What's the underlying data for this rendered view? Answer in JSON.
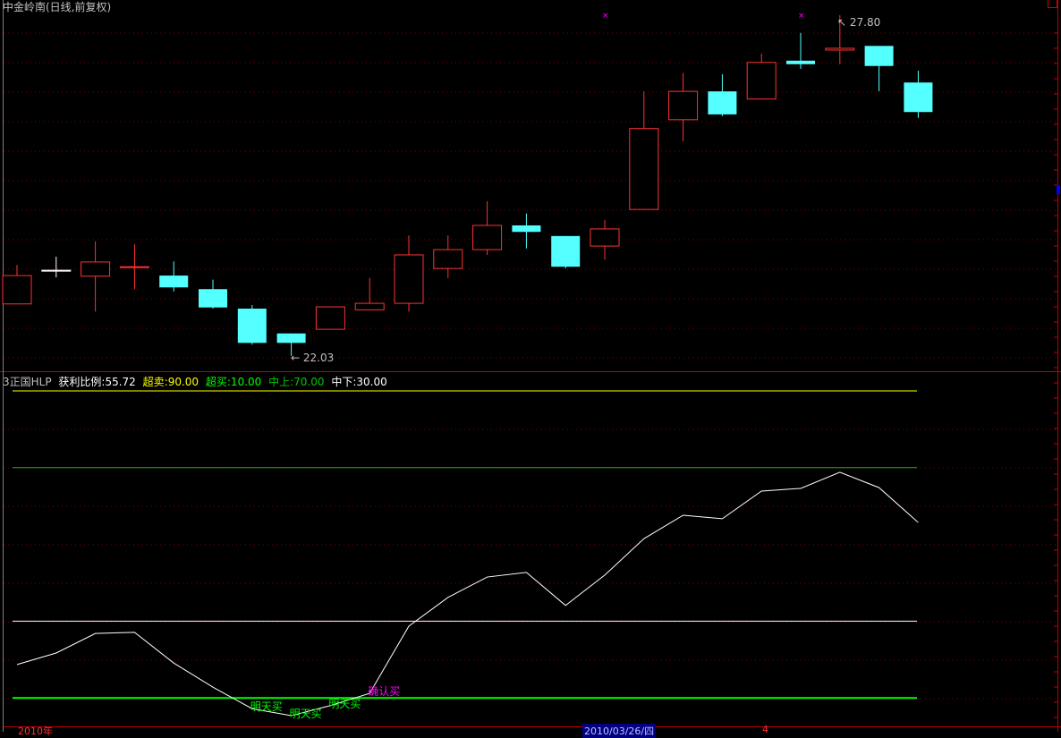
{
  "header": {
    "title": "中金岭南(日线,前复权)"
  },
  "price_panel": {
    "high_label": "27.80",
    "low_label": "22.03",
    "candles": [
      {
        "o": 22.91,
        "h": 23.57,
        "l": 22.91,
        "c": 23.39
      },
      {
        "o": 23.48,
        "h": 23.71,
        "l": 23.36,
        "c": 23.48
      },
      {
        "o": 23.38,
        "h": 23.97,
        "l": 22.78,
        "c": 23.62
      },
      {
        "o": 23.54,
        "h": 23.92,
        "l": 23.16,
        "c": 23.54
      },
      {
        "o": 23.39,
        "h": 23.63,
        "l": 23.12,
        "c": 23.19
      },
      {
        "o": 23.16,
        "h": 23.32,
        "l": 22.83,
        "c": 22.85
      },
      {
        "o": 22.83,
        "h": 22.89,
        "l": 22.22,
        "c": 22.25
      },
      {
        "o": 22.41,
        "h": 22.41,
        "l": 22.03,
        "c": 22.25
      },
      {
        "o": 22.48,
        "h": 22.86,
        "l": 22.48,
        "c": 22.86
      },
      {
        "o": 22.81,
        "h": 23.35,
        "l": 22.81,
        "c": 22.92
      },
      {
        "o": 22.92,
        "h": 24.07,
        "l": 22.78,
        "c": 23.74
      },
      {
        "o": 23.51,
        "h": 24.07,
        "l": 23.35,
        "c": 23.83
      },
      {
        "o": 23.83,
        "h": 24.65,
        "l": 23.74,
        "c": 24.24
      },
      {
        "o": 24.24,
        "h": 24.44,
        "l": 23.85,
        "c": 24.13
      },
      {
        "o": 24.06,
        "h": 24.06,
        "l": 23.51,
        "c": 23.54
      },
      {
        "o": 23.89,
        "h": 24.33,
        "l": 23.66,
        "c": 24.18
      },
      {
        "o": 24.51,
        "h": 26.51,
        "l": 24.51,
        "c": 25.88
      },
      {
        "o": 26.03,
        "h": 26.82,
        "l": 25.66,
        "c": 26.51
      },
      {
        "o": 26.51,
        "h": 26.8,
        "l": 26.09,
        "c": 26.12
      },
      {
        "o": 26.38,
        "h": 27.15,
        "l": 26.38,
        "c": 27.0
      },
      {
        "o": 27.03,
        "h": 27.5,
        "l": 26.89,
        "c": 26.97
      },
      {
        "o": 27.21,
        "h": 27.8,
        "l": 26.97,
        "c": 27.24
      },
      {
        "o": 27.28,
        "h": 27.28,
        "l": 26.51,
        "c": 26.94
      },
      {
        "o": 26.66,
        "h": 26.86,
        "l": 26.06,
        "c": 26.16
      }
    ],
    "markers": [
      15,
      20
    ],
    "colors": {
      "up": "#ff3232",
      "down": "#54ffff",
      "marker": "#ff00ff",
      "grid": "#800000",
      "border": "#c00000"
    }
  },
  "indicator": {
    "name": "3正国HLP",
    "profit_label": "获利比例:55.72",
    "overbought_label": "超卖:90.00",
    "oversold_label": "超买:10.00",
    "mid_upper_label": "中上:70.00",
    "mid_lower_label": "中下:30.00",
    "levels": [
      {
        "v": 90,
        "color": "#ffff00"
      },
      {
        "v": 70,
        "color": "#00c800"
      },
      {
        "v": 30,
        "color": "#ffffff"
      },
      {
        "v": 10,
        "color": "#00ff00"
      }
    ],
    "values": [
      18.7,
      21.7,
      26.8,
      27.1,
      19.1,
      12.8,
      7.2,
      5.4,
      8.0,
      11.2,
      28.7,
      36.2,
      41.5,
      42.7,
      34.1,
      42.0,
      51.5,
      57.6,
      56.7,
      63.9,
      64.6,
      68.8,
      64.8,
      55.72
    ],
    "signals": [
      {
        "index": 6,
        "text": "明天买",
        "color": "#00ff00"
      },
      {
        "index": 7,
        "text": "明天买",
        "color": "#00ff00"
      },
      {
        "index": 8,
        "text": "明天买",
        "color": "#00ff00"
      },
      {
        "index": 9,
        "text": "确认买",
        "color": "#ff00ff"
      }
    ]
  },
  "x_axis": {
    "year_label": "2010年",
    "cursor_date": "2010/03/26/四",
    "month_label": "4"
  }
}
